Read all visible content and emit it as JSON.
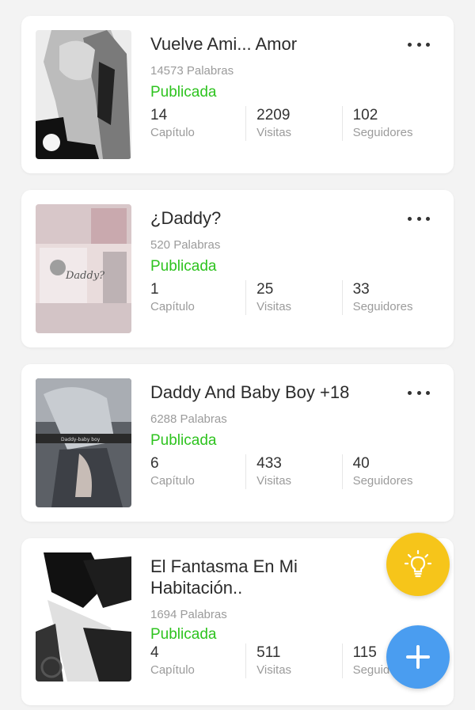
{
  "stories": [
    {
      "title": "Vuelve Ami... Amor",
      "words": "14573 Palabras",
      "status": "Publicada",
      "stats": [
        {
          "value": "14",
          "label": "Capítulo"
        },
        {
          "value": "2209",
          "label": "Visitas"
        },
        {
          "value": "102",
          "label": "Seguidores"
        }
      ]
    },
    {
      "title": "¿Daddy?",
      "words": "520 Palabras",
      "status": "Publicada",
      "stats": [
        {
          "value": "1",
          "label": "Capítulo"
        },
        {
          "value": "25",
          "label": "Visitas"
        },
        {
          "value": "33",
          "label": "Seguidores"
        }
      ]
    },
    {
      "title": "Daddy And Baby Boy +18",
      "words": "6288 Palabras",
      "status": "Publicada",
      "stats": [
        {
          "value": "6",
          "label": "Capítulo"
        },
        {
          "value": "433",
          "label": "Visitas"
        },
        {
          "value": "40",
          "label": "Seguidores"
        }
      ]
    },
    {
      "title": "El Fantasma En Mi Habitación..",
      "words": "1694 Palabras",
      "status": "Publicada",
      "stats": [
        {
          "value": "4",
          "label": "Capítulo"
        },
        {
          "value": "511",
          "label": "Visitas"
        },
        {
          "value": "115",
          "label": "Seguidores"
        }
      ]
    }
  ],
  "colors": {
    "published": "#2ec31f",
    "idea_fab": "#f6c51a",
    "add_fab": "#4a9df0"
  },
  "icons": {
    "more": "more-dots-icon",
    "idea": "lightbulb-icon",
    "add": "plus-icon"
  }
}
